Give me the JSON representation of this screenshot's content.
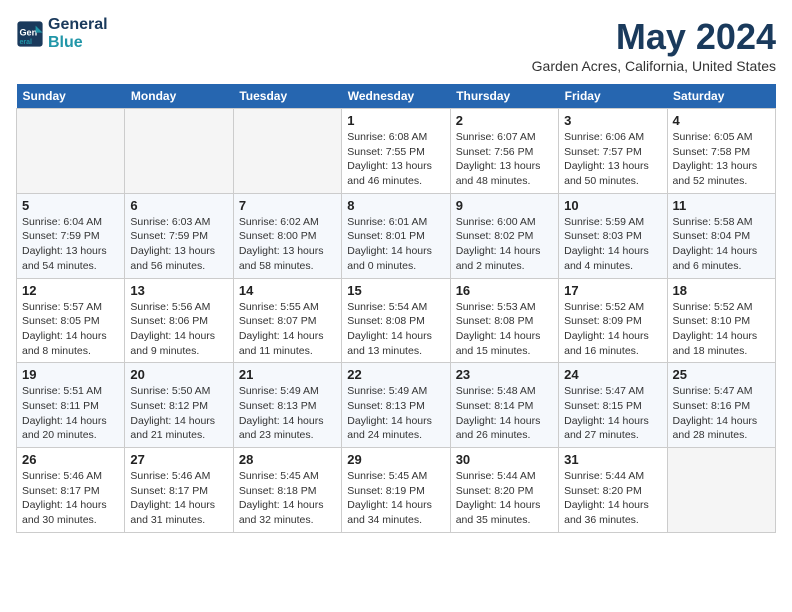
{
  "logo": {
    "line1": "General",
    "line2": "Blue"
  },
  "title": "May 2024",
  "location": "Garden Acres, California, United States",
  "weekdays": [
    "Sunday",
    "Monday",
    "Tuesday",
    "Wednesday",
    "Thursday",
    "Friday",
    "Saturday"
  ],
  "weeks": [
    [
      {
        "num": "",
        "info": "",
        "empty": true
      },
      {
        "num": "",
        "info": "",
        "empty": true
      },
      {
        "num": "",
        "info": "",
        "empty": true
      },
      {
        "num": "1",
        "info": "Sunrise: 6:08 AM\nSunset: 7:55 PM\nDaylight: 13 hours\nand 46 minutes."
      },
      {
        "num": "2",
        "info": "Sunrise: 6:07 AM\nSunset: 7:56 PM\nDaylight: 13 hours\nand 48 minutes."
      },
      {
        "num": "3",
        "info": "Sunrise: 6:06 AM\nSunset: 7:57 PM\nDaylight: 13 hours\nand 50 minutes."
      },
      {
        "num": "4",
        "info": "Sunrise: 6:05 AM\nSunset: 7:58 PM\nDaylight: 13 hours\nand 52 minutes."
      }
    ],
    [
      {
        "num": "5",
        "info": "Sunrise: 6:04 AM\nSunset: 7:59 PM\nDaylight: 13 hours\nand 54 minutes."
      },
      {
        "num": "6",
        "info": "Sunrise: 6:03 AM\nSunset: 7:59 PM\nDaylight: 13 hours\nand 56 minutes."
      },
      {
        "num": "7",
        "info": "Sunrise: 6:02 AM\nSunset: 8:00 PM\nDaylight: 13 hours\nand 58 minutes."
      },
      {
        "num": "8",
        "info": "Sunrise: 6:01 AM\nSunset: 8:01 PM\nDaylight: 14 hours\nand 0 minutes."
      },
      {
        "num": "9",
        "info": "Sunrise: 6:00 AM\nSunset: 8:02 PM\nDaylight: 14 hours\nand 2 minutes."
      },
      {
        "num": "10",
        "info": "Sunrise: 5:59 AM\nSunset: 8:03 PM\nDaylight: 14 hours\nand 4 minutes."
      },
      {
        "num": "11",
        "info": "Sunrise: 5:58 AM\nSunset: 8:04 PM\nDaylight: 14 hours\nand 6 minutes."
      }
    ],
    [
      {
        "num": "12",
        "info": "Sunrise: 5:57 AM\nSunset: 8:05 PM\nDaylight: 14 hours\nand 8 minutes."
      },
      {
        "num": "13",
        "info": "Sunrise: 5:56 AM\nSunset: 8:06 PM\nDaylight: 14 hours\nand 9 minutes."
      },
      {
        "num": "14",
        "info": "Sunrise: 5:55 AM\nSunset: 8:07 PM\nDaylight: 14 hours\nand 11 minutes."
      },
      {
        "num": "15",
        "info": "Sunrise: 5:54 AM\nSunset: 8:08 PM\nDaylight: 14 hours\nand 13 minutes."
      },
      {
        "num": "16",
        "info": "Sunrise: 5:53 AM\nSunset: 8:08 PM\nDaylight: 14 hours\nand 15 minutes."
      },
      {
        "num": "17",
        "info": "Sunrise: 5:52 AM\nSunset: 8:09 PM\nDaylight: 14 hours\nand 16 minutes."
      },
      {
        "num": "18",
        "info": "Sunrise: 5:52 AM\nSunset: 8:10 PM\nDaylight: 14 hours\nand 18 minutes."
      }
    ],
    [
      {
        "num": "19",
        "info": "Sunrise: 5:51 AM\nSunset: 8:11 PM\nDaylight: 14 hours\nand 20 minutes."
      },
      {
        "num": "20",
        "info": "Sunrise: 5:50 AM\nSunset: 8:12 PM\nDaylight: 14 hours\nand 21 minutes."
      },
      {
        "num": "21",
        "info": "Sunrise: 5:49 AM\nSunset: 8:13 PM\nDaylight: 14 hours\nand 23 minutes."
      },
      {
        "num": "22",
        "info": "Sunrise: 5:49 AM\nSunset: 8:13 PM\nDaylight: 14 hours\nand 24 minutes."
      },
      {
        "num": "23",
        "info": "Sunrise: 5:48 AM\nSunset: 8:14 PM\nDaylight: 14 hours\nand 26 minutes."
      },
      {
        "num": "24",
        "info": "Sunrise: 5:47 AM\nSunset: 8:15 PM\nDaylight: 14 hours\nand 27 minutes."
      },
      {
        "num": "25",
        "info": "Sunrise: 5:47 AM\nSunset: 8:16 PM\nDaylight: 14 hours\nand 28 minutes."
      }
    ],
    [
      {
        "num": "26",
        "info": "Sunrise: 5:46 AM\nSunset: 8:17 PM\nDaylight: 14 hours\nand 30 minutes."
      },
      {
        "num": "27",
        "info": "Sunrise: 5:46 AM\nSunset: 8:17 PM\nDaylight: 14 hours\nand 31 minutes."
      },
      {
        "num": "28",
        "info": "Sunrise: 5:45 AM\nSunset: 8:18 PM\nDaylight: 14 hours\nand 32 minutes."
      },
      {
        "num": "29",
        "info": "Sunrise: 5:45 AM\nSunset: 8:19 PM\nDaylight: 14 hours\nand 34 minutes."
      },
      {
        "num": "30",
        "info": "Sunrise: 5:44 AM\nSunset: 8:20 PM\nDaylight: 14 hours\nand 35 minutes."
      },
      {
        "num": "31",
        "info": "Sunrise: 5:44 AM\nSunset: 8:20 PM\nDaylight: 14 hours\nand 36 minutes."
      },
      {
        "num": "",
        "info": "",
        "empty": true
      }
    ]
  ]
}
